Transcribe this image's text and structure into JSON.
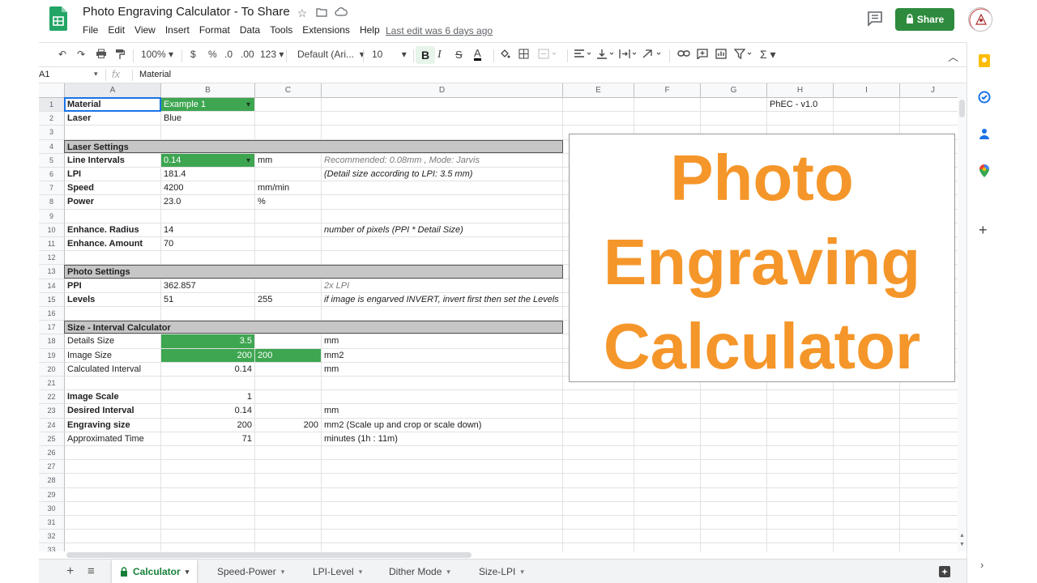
{
  "doc": {
    "title": "Photo Engraving Calculator - To Share",
    "last_edit": "Last edit was 6 days ago",
    "share_label": "Share"
  },
  "menu": [
    "File",
    "Edit",
    "View",
    "Insert",
    "Format",
    "Data",
    "Tools",
    "Extensions",
    "Help"
  ],
  "toolbar": {
    "zoom": "100%",
    "currency": "$",
    "percent": "%",
    "dec_less": ".0",
    "dec_more": ".00",
    "number_format": "123",
    "font": "Default (Ari...",
    "font_size": "10"
  },
  "formula_bar": {
    "cell_ref": "A1",
    "fx": "fx",
    "value": "Material"
  },
  "columns": [
    "A",
    "B",
    "C",
    "D",
    "E",
    "F",
    "G",
    "H",
    "I",
    "J"
  ],
  "rows": [
    "1",
    "2",
    "3",
    "4",
    "5",
    "6",
    "7",
    "8",
    "9",
    "10",
    "11",
    "12",
    "13",
    "14",
    "15",
    "16",
    "17",
    "18",
    "19",
    "20",
    "21",
    "22",
    "23",
    "24",
    "25",
    "26",
    "27",
    "28",
    "29",
    "30",
    "31",
    "32",
    "33"
  ],
  "cells": {
    "a1": "Material",
    "b1": "Example 1",
    "h1": "PhEC - v1.0",
    "a2": "Laser",
    "b2": "Blue",
    "a4": "Laser Settings",
    "a5": "Line Intervals",
    "b5": "0.14",
    "c5": "mm",
    "d5": "Recommended: 0.08mm , Mode: Jarvis",
    "a6": "LPI",
    "b6": "181.4",
    "d6": "(Detail size according to LPI: 3.5 mm)",
    "a7": "Speed",
    "b7": "4200",
    "c7": "mm/min",
    "a8": "Power",
    "b8": "23.0",
    "c8": "%",
    "a10": "Enhance. Radius",
    "b10": "14",
    "d10": "number of pixels (PPI * Detail Size)",
    "a11": "Enhance. Amount",
    "b11": "70",
    "a13": "Photo Settings",
    "a14": "PPI",
    "b14": "362.857",
    "d14": "2x LPI",
    "a15": "Levels",
    "b15": "51",
    "c15": "255",
    "d15": "if image is engarved INVERT, invert first then set the Levels",
    "a17": "Size - Interval Calculator",
    "a18": "Details Size",
    "b18": "3.5",
    "d18": "mm",
    "a19": "Image Size",
    "b19": "200",
    "c19": "200",
    "d19": "mm2",
    "a20": "Calculated Interval",
    "b20": "0.14",
    "d20": "mm",
    "a22": "Image Scale",
    "b22": "1",
    "a23": "Desired Interval",
    "b23": "0.14",
    "d23": "mm",
    "a24": "Engraving size",
    "b24": "200",
    "c24": "200",
    "d24": "mm2 (Scale up and crop or scale down)",
    "a25": "Approximated Time",
    "b25": "71",
    "d25": "minutes (1h : 11m)"
  },
  "banner": {
    "line1": "Photo",
    "line2": "Engraving",
    "line3": "Calculator",
    "color": "#f5962a"
  },
  "sheets": [
    {
      "label": "Calculator",
      "active": true
    },
    {
      "label": "Speed-Power"
    },
    {
      "label": "LPI-Level"
    },
    {
      "label": "Dither Mode"
    },
    {
      "label": "Size-LPI"
    }
  ],
  "colors": {
    "accent_green": "#3ea651",
    "share_green": "#2e8b3d",
    "section_gray": "#c6c6c6"
  },
  "icons": [
    "undo-icon",
    "redo-icon",
    "print-icon",
    "paint-format-icon",
    "bold-icon",
    "italic-icon",
    "strikethrough-icon",
    "text-color-icon",
    "fill-color-icon",
    "borders-icon",
    "merge-icon",
    "align-icon",
    "valign-icon",
    "wrap-icon",
    "rotate-icon",
    "link-icon",
    "comment-icon",
    "chart-icon",
    "filter-icon",
    "functions-icon",
    "keep-icon",
    "tasks-icon",
    "contacts-icon",
    "maps-icon",
    "add-icon"
  ]
}
